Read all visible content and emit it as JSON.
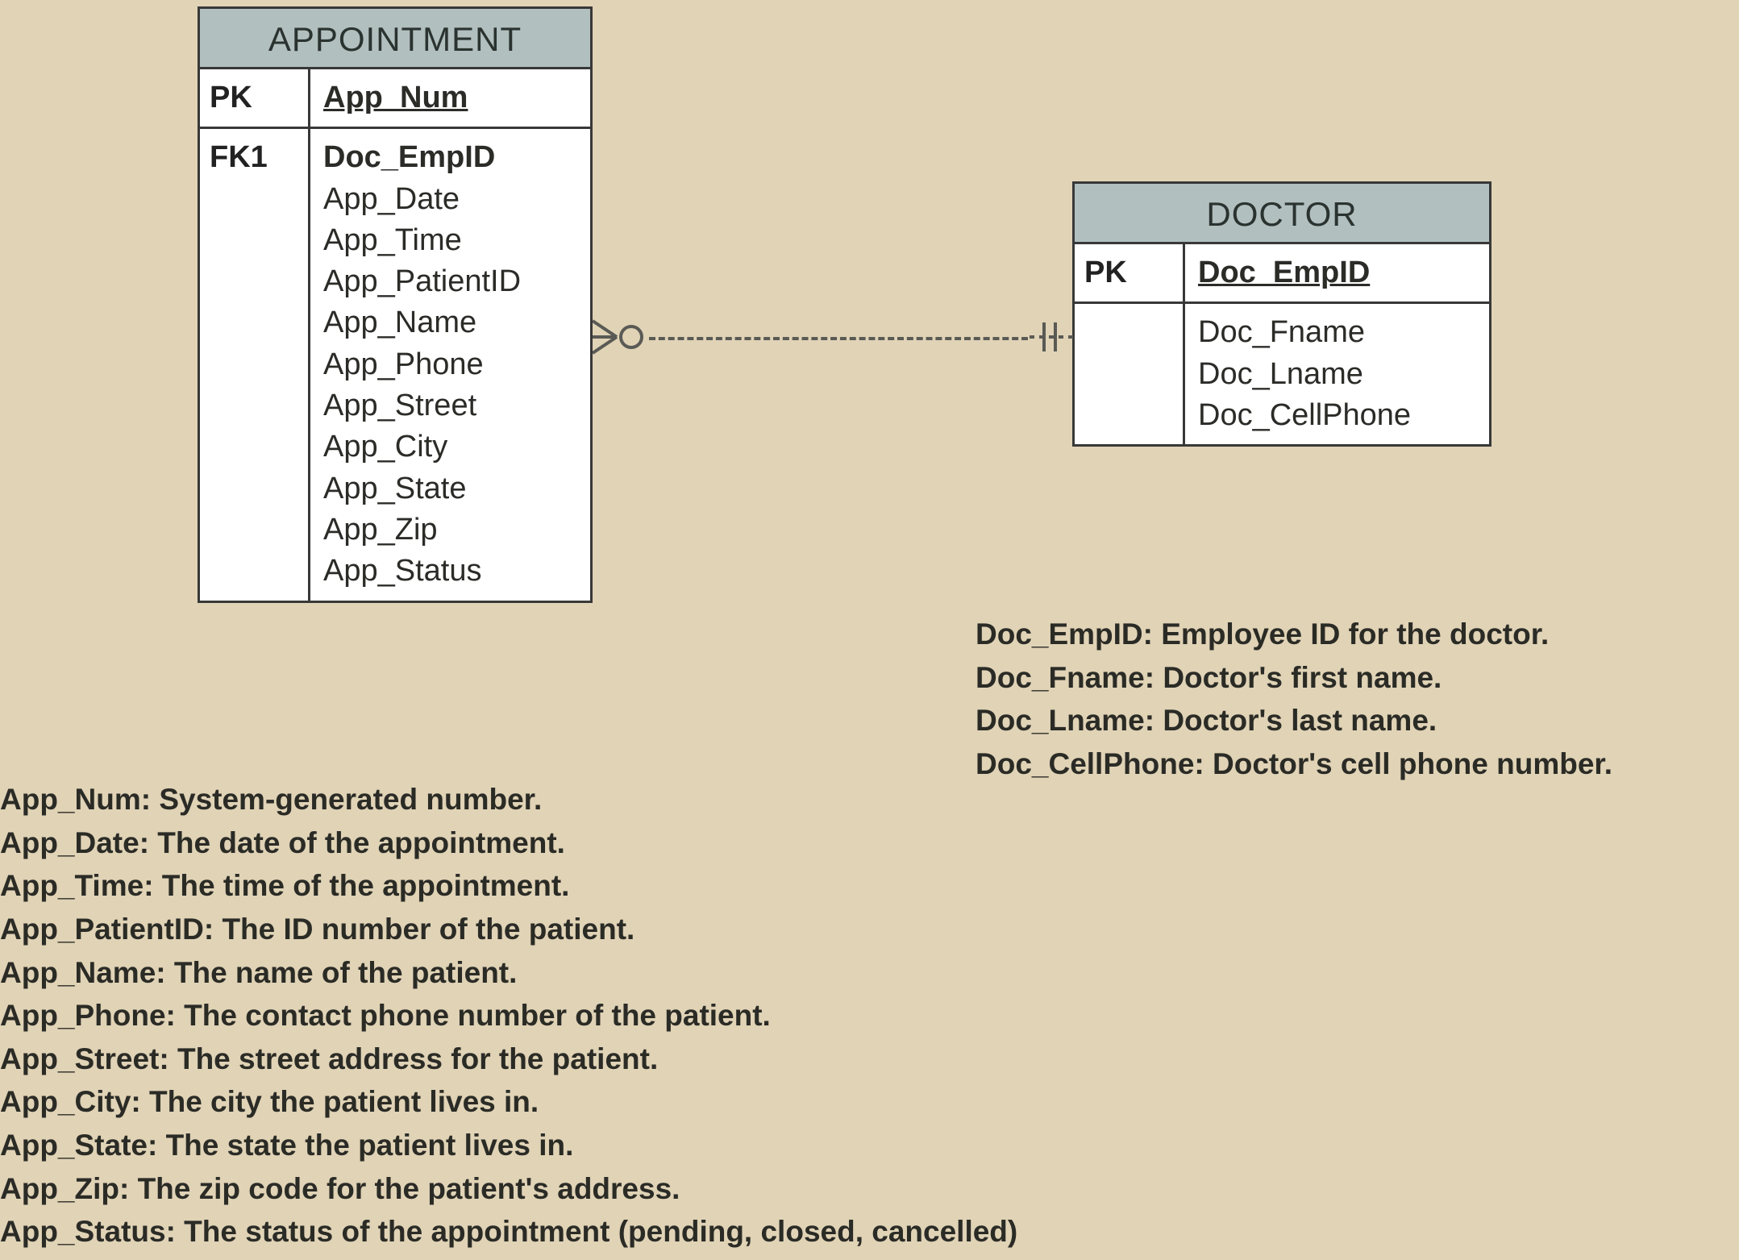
{
  "entities": {
    "appointment": {
      "title": "APPOINTMENT",
      "pk_label": "PK",
      "pk_attr": "App_Num",
      "fk_label": "FK1",
      "attrs": [
        "Doc_EmpID",
        "App_Date",
        "App_Time",
        "App_PatientID",
        "App_Name",
        "App_Phone",
        "App_Street",
        "App_City",
        "App_State",
        "App_Zip",
        "App_Status"
      ]
    },
    "doctor": {
      "title": "DOCTOR",
      "pk_label": "PK",
      "pk_attr": "Doc_EmpID",
      "attrs": [
        "Doc_Fname",
        "Doc_Lname",
        "Doc_CellPhone"
      ]
    }
  },
  "descriptions": {
    "doctor": [
      "Doc_EmpID: Employee ID for the doctor.",
      "Doc_Fname: Doctor's first name.",
      "Doc_Lname: Doctor's last name.",
      "Doc_CellPhone: Doctor's cell phone number."
    ],
    "appointment": [
      "App_Num: System-generated number.",
      "App_Date: The date of the appointment.",
      "App_Time: The time of the appointment.",
      "App_PatientID: The ID number of the patient.",
      "App_Name: The name of the patient.",
      "App_Phone: The contact phone number of the patient.",
      "App_Street: The street address for the patient.",
      "App_City: The city the patient lives in.",
      "App_State:  The state the patient lives in.",
      "App_Zip:  The zip code for the patient's address.",
      "App_Status: The status of the appointment (pending, closed, cancelled)"
    ]
  }
}
